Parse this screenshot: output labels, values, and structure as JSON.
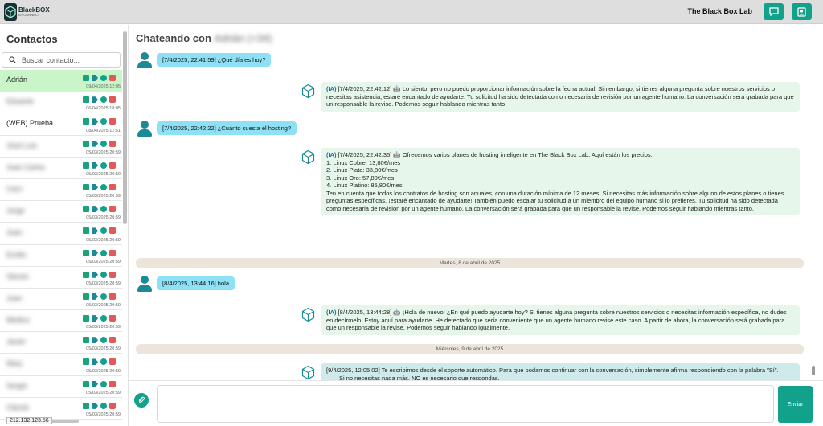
{
  "topbar": {
    "logo_text": "BlackBOX",
    "logo_sub": "BY CONNECT",
    "brand": "The Black Box Lab",
    "chat_button_icon": "chat-bubble-icon",
    "profile_button_icon": "profile-icon"
  },
  "sidebar": {
    "title": "Contactos",
    "search_placeholder": "Buscar contacto...",
    "contacts": [
      {
        "name": "Adrián",
        "date": "09/04/2025 12:05",
        "blurred": false,
        "active": true
      },
      {
        "name": "Eduardo",
        "date": "06/04/2025 18:05",
        "blurred": true,
        "active": false
      },
      {
        "name": "(WEB) Prueba",
        "date": "08/04/2025 12:51",
        "blurred": false,
        "active": false
      },
      {
        "name": "José Luis",
        "date": "05/03/2025 20:59",
        "blurred": true,
        "active": false
      },
      {
        "name": "Juan Carlos",
        "date": "05/03/2025 20:59",
        "blurred": true,
        "active": false
      },
      {
        "name": "Caro",
        "date": "05/03/2025 20:59",
        "blurred": true,
        "active": false
      },
      {
        "name": "Jorge",
        "date": "05/03/2025 20:59",
        "blurred": true,
        "active": false
      },
      {
        "name": "Juan",
        "date": "05/03/2025 20:59",
        "blurred": true,
        "active": false
      },
      {
        "name": "Emilio",
        "date": "05/03/2025 20:59",
        "blurred": true,
        "active": false
      },
      {
        "name": "Steven",
        "date": "05/03/2025 20:59",
        "blurred": true,
        "active": false
      },
      {
        "name": "Juan",
        "date": "05/03/2025 20:59",
        "blurred": true,
        "active": false
      },
      {
        "name": "Medico",
        "date": "05/03/2025 20:59",
        "blurred": true,
        "active": false
      },
      {
        "name": "Javier",
        "date": "05/03/2025 20:59",
        "blurred": true,
        "active": false
      },
      {
        "name": "Mary",
        "date": "05/03/2025 20:59",
        "blurred": true,
        "active": false
      },
      {
        "name": "Sergio",
        "date": "05/03/2025 20:59",
        "blurred": true,
        "active": false
      },
      {
        "name": "Cliente",
        "date": "05/03/2025 20:59",
        "blurred": true,
        "active": false
      }
    ],
    "ip": "212.132.123.56"
  },
  "chat": {
    "title_prefix": "Chateando con",
    "title_contact": "Adrián (+34)",
    "messages": [
      {
        "type": "user",
        "text": "[7/4/2025, 22:41:59] ¿Qué día es hoy?"
      },
      {
        "type": "ia",
        "tag": "(IA)",
        "text": "[7/4/2025, 22:42:12] 🤖 Lo siento, pero no puedo proporcionar información sobre la fecha actual. Sin embargo, si tienes alguna pregunta sobre nuestros servicios o necesitas asistencia, estaré encantado de ayudarte. Tu solicitud ha sido detectada como necesaria de revisión por un agente humano. La conversación será grabada para que un responsable la revise. Podemos seguir hablando mientras tanto."
      },
      {
        "type": "user",
        "text": "[7/4/2025, 22:42:22] ¿Cuánto cuesta el hosting?"
      },
      {
        "type": "ia",
        "tag": "(IA)",
        "text": "[7/4/2025, 22:42:35] 🤖 Ofrecemos varios planes de hosting inteligente en The Black Box Lab. Aquí están los precios:",
        "lines": [
          "1. Linux Cobre: 13,80€/mes",
          "2. Linux Plata: 33,80€/mes",
          "3. Linux Oro: 57,80€/mes",
          "4. Linux Platino: 85,80€/mes"
        ],
        "tail": "Ten en cuenta que todos los contratos de hosting son anuales, con una duración mínima de 12 meses. Si necesitas más información sobre alguno de estos planes o tienes preguntas específicas, ¡estaré encantado de ayudarte! También puedo escalar tu solicitud a un miembro del equipo humano si lo prefieres. Tu solicitud ha sido detectada como necesaria de revisión por un agente humano. La conversación será grabada para que un responsable la revise. Podemos seguir hablando mientras tanto."
      },
      {
        "type": "date",
        "text": "Martes, 8 de abril de 2025"
      },
      {
        "type": "user",
        "text": "[8/4/2025, 13:44:16] hola"
      },
      {
        "type": "ia",
        "tag": "(IA)",
        "text": "[8/4/2025, 13:44:28] 🤖 ¡Hola de nuevo! ¿En qué puedo ayudarte hoy? Si tienes alguna pregunta sobre nuestros servicios o necesitas información específica, no dudes en decírmelo. Estoy aquí para ayudarte. He detectado que sería conveniente que un agente humano revise este caso. A partir de ahora, la conversación será grabada para que un responsable la revise. Podemos seguir hablando igualmente."
      },
      {
        "type": "date",
        "text": "Miércoles, 9 de abril de 2025"
      },
      {
        "type": "auto",
        "text": "[9/4/2025, 12:05:02] Te escribimos desde el soporte automático. Para que podamos continuar con la conversación, simplemente afirma respondiendo con la palabra \"Sí\".",
        "tail": "Si no necesitas nada más, NO es necesario que respondas."
      }
    ]
  },
  "composer": {
    "placeholder": "",
    "send_label": "Enviar",
    "attach_icon": "paperclip-icon"
  }
}
